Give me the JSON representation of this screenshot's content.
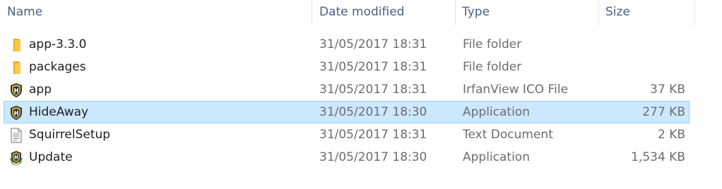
{
  "columns": {
    "name": "Name",
    "date": "Date modified",
    "type": "Type",
    "size": "Size"
  },
  "sort_indicator": "^",
  "files": [
    {
      "name": "app-3.3.0",
      "date": "31/05/2017 18:31",
      "type": "File folder",
      "size": "",
      "icon": "folder-icon",
      "selected": false
    },
    {
      "name": "packages",
      "date": "31/05/2017 18:31",
      "type": "File folder",
      "size": "",
      "icon": "folder-icon",
      "selected": false
    },
    {
      "name": "app",
      "date": "31/05/2017 18:31",
      "type": "IrfanView ICO File",
      "size": "37 KB",
      "icon": "hideaway-shield-icon",
      "selected": false
    },
    {
      "name": "HideAway",
      "date": "31/05/2017 18:30",
      "type": "Application",
      "size": "277 KB",
      "icon": "hideaway-shield-icon",
      "selected": true
    },
    {
      "name": "SquirrelSetup",
      "date": "31/05/2017 18:31",
      "type": "Text Document",
      "size": "2 KB",
      "icon": "text-document-icon",
      "selected": false
    },
    {
      "name": "Update",
      "date": "31/05/2017 18:30",
      "type": "Application",
      "size": "1,534 KB",
      "icon": "update-installer-icon",
      "selected": false
    }
  ],
  "colors": {
    "header_text": "#4d6082",
    "selection_fill": "#cce8ff",
    "selection_border": "#99d1ff",
    "folder": "#f8c94a"
  }
}
